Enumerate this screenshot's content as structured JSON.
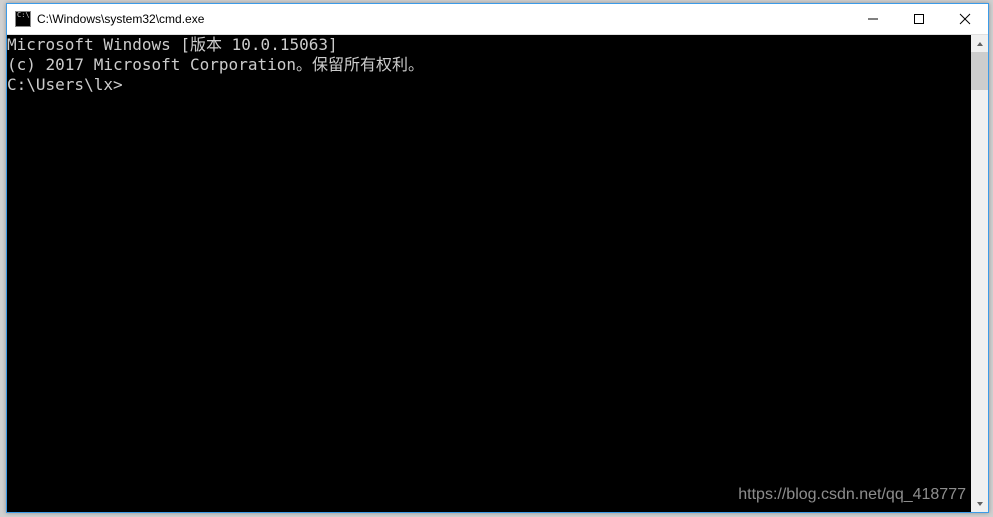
{
  "window": {
    "title": "C:\\Windows\\system32\\cmd.exe"
  },
  "console": {
    "line1": "Microsoft Windows [版本 10.0.15063]",
    "line2": "(c) 2017 Microsoft Corporation。保留所有权利。",
    "blank": "",
    "prompt": "C:\\Users\\lx>"
  },
  "watermark": "https://blog.csdn.net/qq_418777"
}
